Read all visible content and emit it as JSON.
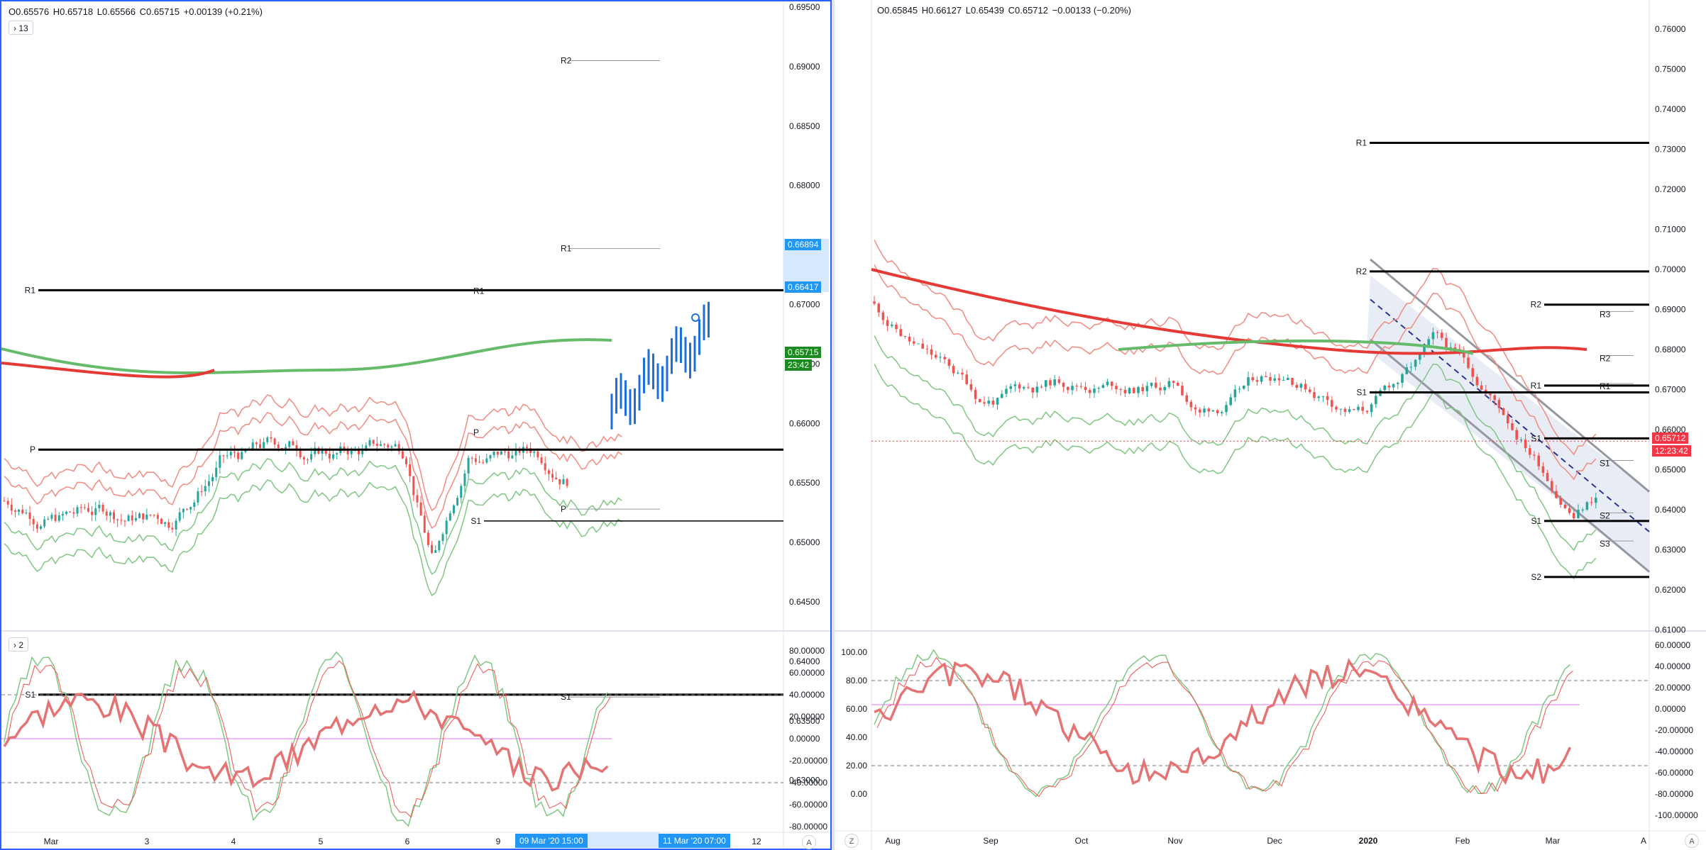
{
  "left": {
    "ohlc": {
      "o": "O0.65576",
      "h": "H0.65718",
      "l": "L0.65566",
      "c": "C0.65715",
      "chg": "+0.00139 (+0.21%)"
    },
    "indicator_count": "13",
    "osc_count": "2",
    "price_ticks": [
      "0.69500",
      "0.69000",
      "0.68500",
      "0.68000",
      "0.67500",
      "0.67000",
      "0.66500",
      "0.66000",
      "0.65500",
      "0.65000",
      "0.64500",
      "0.64000",
      "0.63500",
      "0.63000"
    ],
    "osc_ticks": [
      "80.00000",
      "60.00000",
      "40.00000",
      "20.00000",
      "0.00000",
      "-20.00000",
      "-40.00000",
      "-60.00000",
      "-80.00000"
    ],
    "time_labels": [
      "Mar",
      "3",
      "4",
      "5",
      "6",
      "9",
      "12"
    ],
    "time_highlight_1": "09 Mar '20   15:00",
    "time_highlight_2": "11 Mar '20   07:00",
    "price_tags": [
      "0.66894",
      "0.66417",
      "0.65715",
      "23:42"
    ],
    "pivots": {
      "r1": "R1",
      "r1b": "R1",
      "p": "P",
      "p2": "P",
      "s1": "S1",
      "s1b": "S1",
      "r2f": "R2",
      "r1f": "R1",
      "pf": "P",
      "s1f": "S1"
    },
    "axis_btn": "A"
  },
  "right": {
    "ohlc": {
      "o": "O0.65845",
      "h": "H0.66127",
      "l": "L0.65439",
      "c": "C0.65712",
      "chg": "−0.00133 (−0.20%)"
    },
    "price_ticks": [
      "0.76000",
      "0.75000",
      "0.74000",
      "0.73000",
      "0.72000",
      "0.71000",
      "0.70000",
      "0.69000",
      "0.68000",
      "0.67000",
      "0.66000",
      "0.65000",
      "0.64000",
      "0.63000",
      "0.62000",
      "0.61000"
    ],
    "osc_left_ticks": [
      "100.00",
      "80.00",
      "60.00",
      "40.00",
      "20.00",
      "0.00"
    ],
    "osc_right_ticks": [
      "60.00000",
      "40.00000",
      "20.00000",
      "0.00000",
      "-20.00000",
      "-40.00000",
      "-60.00000",
      "-80.00000",
      "-100.00000"
    ],
    "time_labels": [
      "Aug",
      "Sep",
      "Oct",
      "Nov",
      "Dec",
      "2020",
      "Feb",
      "Mar",
      "A"
    ],
    "price_tags": [
      "0.65712",
      "12:23:42"
    ],
    "pivots": {
      "r1": "R1",
      "r2": "R2",
      "r1b": "R1",
      "s1": "S1",
      "s1b": "S1",
      "s2": "S2",
      "r3f": "R3",
      "r2f": "R2",
      "r1f": "R1",
      "s1f": "S1",
      "s2f": "S2",
      "s3f": "S3"
    },
    "axis_btn": "A",
    "z_btn": "Z"
  },
  "colors": {
    "bull": "#26a69a",
    "bear": "#ef5350",
    "green_line": "#4caf50",
    "red_band": "#f44336",
    "blue": "#1e6fd9",
    "accent": "#2962ff"
  }
}
